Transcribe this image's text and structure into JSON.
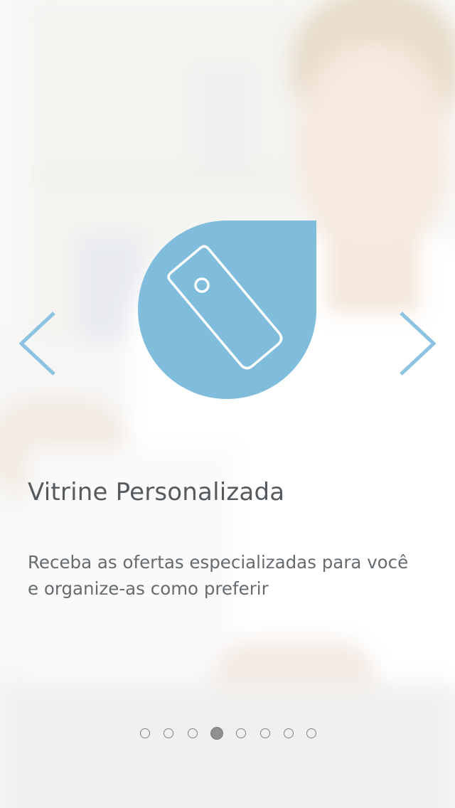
{
  "slide": {
    "title": "Vitrine Personalizada",
    "description_line1": "Receba as ofertas especializadas para você",
    "description_line2": "e organize-as como preferir",
    "icon": "price-tag-icon"
  },
  "navigation": {
    "prev_icon": "chevron-left-icon",
    "next_icon": "chevron-right-icon"
  },
  "pagination": {
    "total": 8,
    "current": 4
  },
  "colors": {
    "accent": "#80bddc",
    "arrow": "#8cc3e3",
    "title_text": "#555a5e",
    "body_text": "#666b6f"
  }
}
